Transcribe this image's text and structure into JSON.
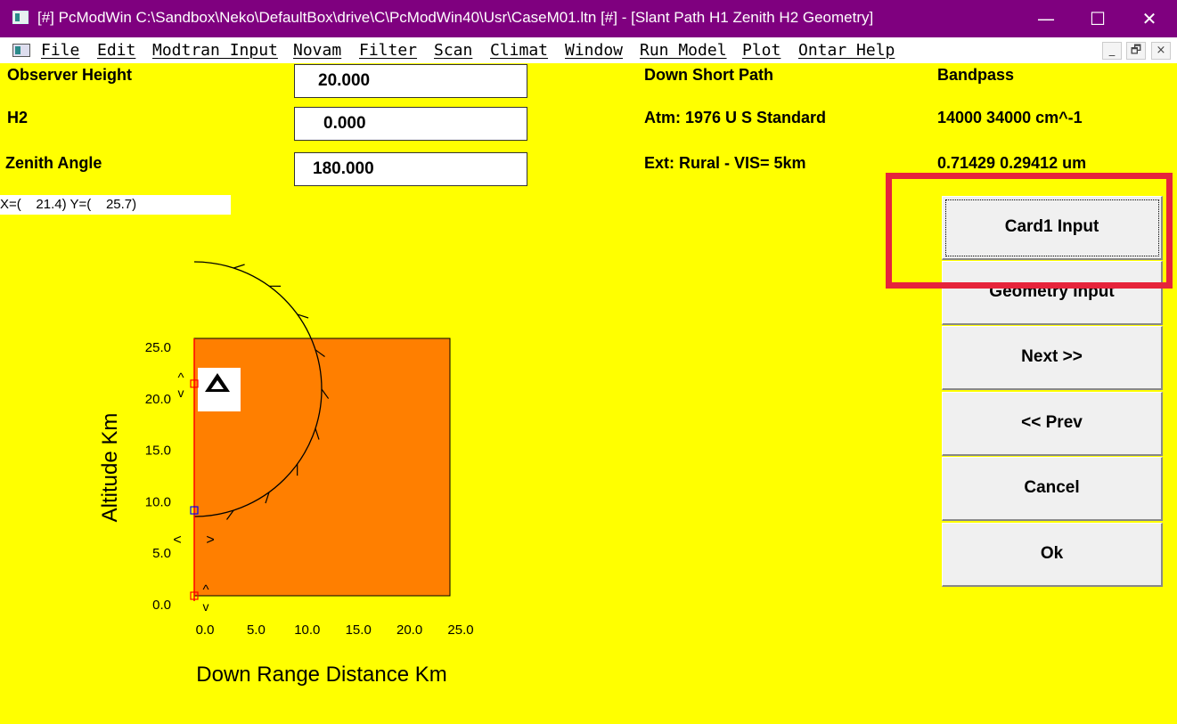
{
  "window": {
    "title": "[#] PcModWin C:\\Sandbox\\Neko\\DefaultBox\\drive\\C\\PcModWin40\\Usr\\CaseM01.ltn [#] - [Slant Path H1 Zenith H2 Geometry]",
    "minimize_glyph": "—",
    "maximize_glyph": "☐",
    "close_glyph": "✕"
  },
  "menubar": {
    "items": [
      "File",
      "Edit",
      "Modtran Input",
      "Novam",
      "Filter",
      "Scan",
      "Climat",
      "Window",
      "Run Model",
      "Plot",
      "Ontar Help"
    ],
    "mdi_buttons": [
      "_",
      "🗗",
      "×"
    ]
  },
  "form": {
    "observer_height": {
      "label": "Observer Height",
      "value": "20.000"
    },
    "h2": {
      "label": "H2",
      "value": "0.000"
    },
    "zenith_angle": {
      "label": "Zenith Angle",
      "value": "180.000"
    }
  },
  "coords_readout": "X=(    21.4) Y=(    25.7)",
  "info": {
    "path_type": "Down Short Path",
    "atmosphere": "Atm: 1976 U S  Standard",
    "extinction": "Ext: Rural - VIS= 5km",
    "band_title": "Bandpass",
    "band_wavenumber": "14000 34000 cm^-1",
    "band_wavelength": "0.71429 0.29412 um"
  },
  "buttons": {
    "card1": "Card1 Input",
    "geometry": "Geometry Input",
    "next": "Next >>",
    "prev": "<< Prev",
    "cancel": "Cancel",
    "ok": "Ok"
  },
  "chart_data": {
    "type": "scatter",
    "xlabel": "Down Range Distance Km",
    "ylabel": "Altitude Km",
    "x_ticks": [
      "0.0",
      "5.0",
      "10.0",
      "15.0",
      "20.0",
      "25.0"
    ],
    "y_ticks": [
      "0.0",
      "5.0",
      "10.0",
      "15.0",
      "20.0",
      "25.0"
    ],
    "xlim": [
      0,
      25
    ],
    "ylim": [
      0,
      25
    ],
    "h1_marker_y": 20.6,
    "h2_marker_y": 0.0,
    "curve_marker_y": 8.3,
    "arrow_glyphs": {
      "up": "^",
      "down": "v",
      "left": "<",
      "right": ">"
    },
    "colors": {
      "plot_background": "#ff7f00",
      "axis": "#ff0000",
      "marker_h": "#ff0000",
      "marker_curve": "#0000ff"
    }
  }
}
